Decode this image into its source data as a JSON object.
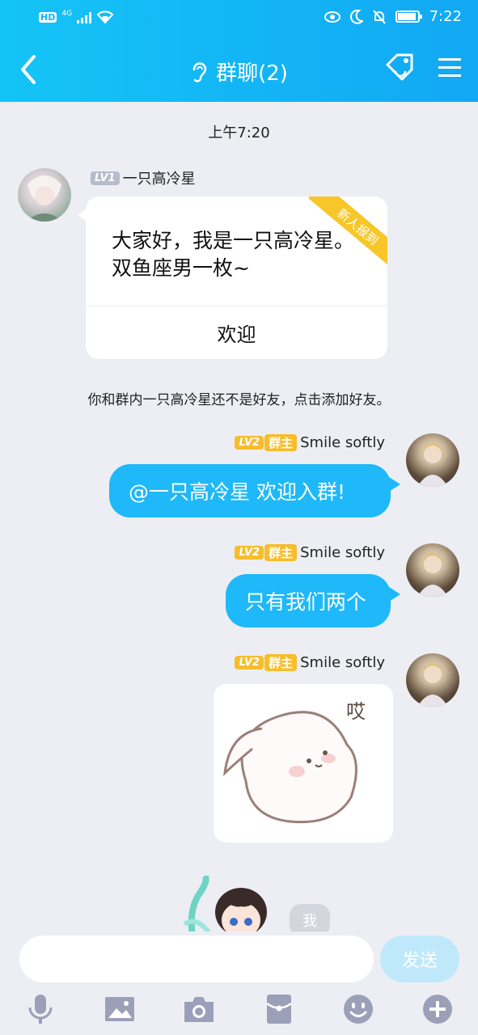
{
  "status_bar": {
    "network": "4G",
    "hd": "HD",
    "time": "7:22"
  },
  "header": {
    "title": "群聊(2)"
  },
  "chat": {
    "timestamp": "上午7:20",
    "incoming": {
      "level": "LV1",
      "sender": "一只高冷星",
      "ribbon": "新人报到",
      "message": "大家好，我是一只高冷星。双鱼座男一枚~",
      "action": "欢迎"
    },
    "notice": "你和群内一只高冷星还不是好友，点击添加好友。",
    "outgoing": [
      {
        "level": "LV2",
        "role": "群主",
        "sender": "Smile softly",
        "text": "@一只高冷星 欢迎入群!"
      },
      {
        "level": "LV2",
        "role": "群主",
        "sender": "Smile softly",
        "text": "只有我们两个"
      },
      {
        "level": "LV2",
        "role": "群主",
        "sender": "Smile softly",
        "sticker_text": "哎"
      }
    ],
    "me_label": "我"
  },
  "input": {
    "placeholder": "",
    "send_label": "发送"
  },
  "toolbar": {
    "icons": [
      "microphone-icon",
      "image-icon",
      "camera-icon",
      "red-packet-icon",
      "emoji-icon",
      "plus-icon"
    ]
  },
  "colors": {
    "header": "#14b6f5",
    "bubble": "#1fb8f8",
    "background": "#eceef4",
    "badge": "#f6bd2c"
  }
}
